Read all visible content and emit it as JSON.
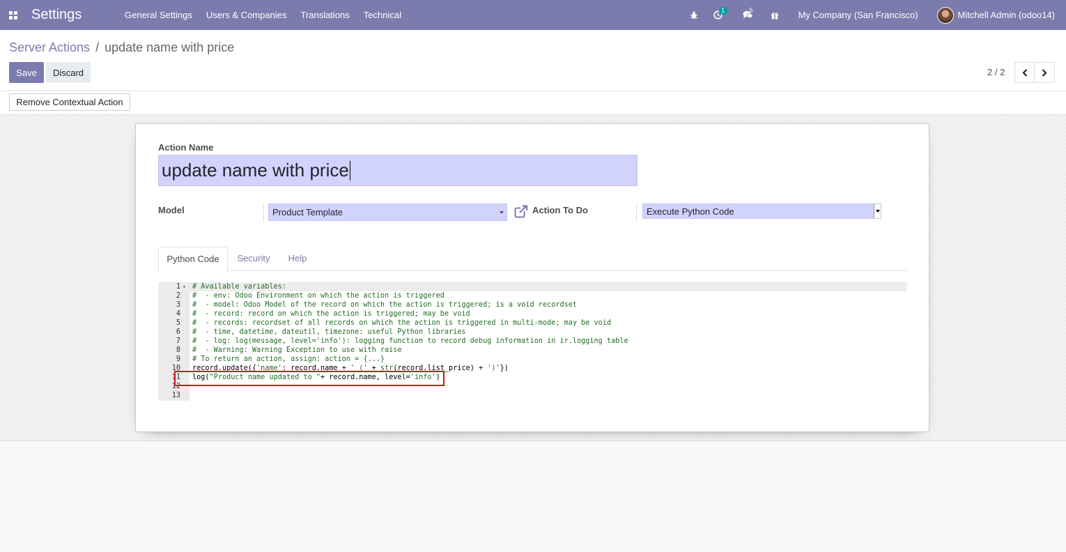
{
  "navbar": {
    "app_title": "Settings",
    "menu": [
      "General Settings",
      "Users & Companies",
      "Translations",
      "Technical"
    ],
    "activity_count": "1",
    "messages_count": "5",
    "company": "My Company (San Francisco)",
    "user": "Mitchell Admin (odoo14)"
  },
  "breadcrumb": {
    "parent": "Server Actions",
    "separator": "/",
    "current": "update name with price"
  },
  "buttons": {
    "save": "Save",
    "discard": "Discard",
    "remove_contextual": "Remove Contextual Action"
  },
  "pager": {
    "value": "2 / 2"
  },
  "form": {
    "action_name_label": "Action Name",
    "action_name_value": "update name with price",
    "model_label": "Model",
    "model_value": "Product Template",
    "action_to_do_label": "Action To Do",
    "action_to_do_value": "Execute Python Code"
  },
  "tabs": [
    "Python Code",
    "Security",
    "Help"
  ],
  "code_lines": [
    {
      "n": "1",
      "parts": [
        {
          "t": "# Available variables:",
          "c": "comment"
        }
      ]
    },
    {
      "n": "2",
      "parts": [
        {
          "t": "#  - env: Odoo Environment on which the action is triggered",
          "c": "comment"
        }
      ]
    },
    {
      "n": "3",
      "parts": [
        {
          "t": "#  - model: Odoo Model of the record on which the action is triggered; is a void recordset",
          "c": "comment"
        }
      ]
    },
    {
      "n": "4",
      "parts": [
        {
          "t": "#  - record: record on which the action is triggered; may be void",
          "c": "comment"
        }
      ]
    },
    {
      "n": "5",
      "parts": [
        {
          "t": "#  - records: recordset of all records on which the action is triggered in multi-mode; may be void",
          "c": "comment"
        }
      ]
    },
    {
      "n": "6",
      "parts": [
        {
          "t": "#  - time, datetime, dateutil, timezone: useful Python libraries",
          "c": "comment"
        }
      ]
    },
    {
      "n": "7",
      "parts": [
        {
          "t": "#  - log: log(message, level='info'): logging function to record debug information in ir.logging table",
          "c": "comment"
        }
      ]
    },
    {
      "n": "8",
      "parts": [
        {
          "t": "#  - Warning: Warning Exception to use with raise",
          "c": "comment"
        }
      ]
    },
    {
      "n": "9",
      "parts": [
        {
          "t": "# To return an action, assign: action = {...}",
          "c": "comment"
        }
      ]
    },
    {
      "n": "10",
      "parts": [
        {
          "t": "record.update({",
          "c": "plain"
        },
        {
          "t": "'name'",
          "c": "strg"
        },
        {
          "t": ": record.name + ",
          "c": "plain"
        },
        {
          "t": "' ('",
          "c": "strg"
        },
        {
          "t": " + ",
          "c": "plain"
        },
        {
          "t": "str",
          "c": "strg"
        },
        {
          "t": "(record.list_price) + ",
          "c": "plain"
        },
        {
          "t": "')'",
          "c": "strg"
        },
        {
          "t": "})",
          "c": "plain"
        }
      ]
    },
    {
      "n": "11",
      "parts": [
        {
          "t": "log(",
          "c": "plain"
        },
        {
          "t": "\"Product name updated to \"",
          "c": "strg"
        },
        {
          "t": "+ record.name, level=",
          "c": "plain"
        },
        {
          "t": "'info'",
          "c": "strg"
        },
        {
          "t": ")",
          "c": "plain"
        }
      ]
    },
    {
      "n": "12",
      "parts": []
    },
    {
      "n": "13",
      "parts": []
    }
  ],
  "colors": {
    "brand": "#7c7bad",
    "field_bg": "#d2d2ff",
    "highlight_border": "#d3101a"
  },
  "icons": [
    "apps-icon",
    "bug-icon",
    "clock-icon",
    "chat-icon",
    "gift-icon",
    "chevron-left-icon",
    "chevron-right-icon",
    "external-link-icon"
  ]
}
